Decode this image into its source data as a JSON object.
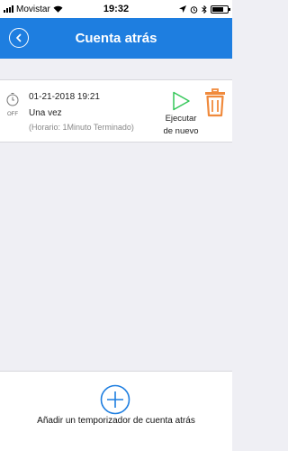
{
  "status_bar": {
    "carrier": "Movistar",
    "time": "19:32"
  },
  "nav": {
    "title": "Cuenta atrás",
    "back_icon": "chevron-left-circle-icon"
  },
  "timers": [
    {
      "switch_state": "OFF",
      "date": "01-21-2018 19:21",
      "repeat": "Una vez",
      "schedule": "(Horario: 1Minuto Terminado)",
      "run_label_line1": "Ejecutar",
      "run_label_line2": "de nuevo",
      "run_icon": "play-icon",
      "delete_icon": "trash-icon"
    }
  ],
  "footer": {
    "add_label": "Añadir un temporizador de cuenta atrás",
    "add_icon": "plus-circle-icon"
  },
  "colors": {
    "nav_bar": "#1e7ee0",
    "play": "#34c759",
    "trash": "#f08a3c",
    "add": "#1e7ee0"
  }
}
